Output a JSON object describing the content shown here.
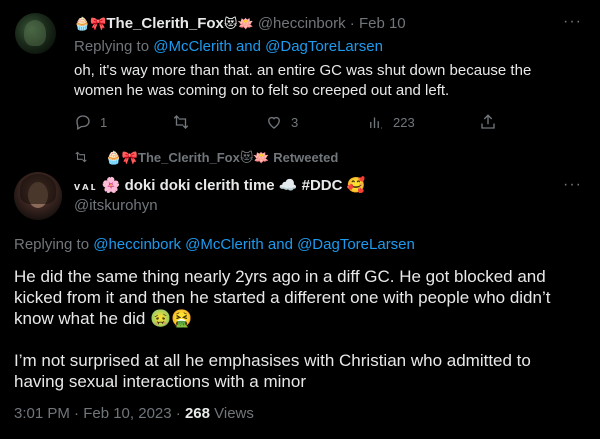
{
  "tweet1": {
    "emoji_prefix": "🧁🎀",
    "display_name": "The_Clerith_Fox",
    "emoji_suffix": "😻🪷",
    "handle": "@heccinbork",
    "date": "· Feb 10",
    "replying_prefix": "Replying to",
    "replying_to": "@McClerith and @DagToreLarsen",
    "text": "oh, it's way more than that. an entire GC was shut down because the women he was coming on to felt so creeped out and left.",
    "reply_count": "1",
    "retweet_count": "",
    "like_count": "3",
    "view_count": "223"
  },
  "retweeted_by": {
    "emoji_prefix": "🧁🎀",
    "name": "The_Clerith_Fox",
    "emoji_suffix": "😻🪷",
    "label": "Retweeted"
  },
  "tweet2": {
    "name_prefix": "ᴠᴀʟ",
    "display_name": "🌸 doki doki clerith time ☁️ #DDC 🥰",
    "handle": "@itskurohyn",
    "replying_prefix": "Replying to",
    "replying_to": "@heccinbork @McClerith and @DagToreLarsen",
    "paragraph1": "He did the same thing nearly 2yrs ago in a diff GC. He got blocked and kicked from it and then he started a different one with people who didn’t know what he did 🤢🤮",
    "paragraph2": "I’m not surprised at all he emphasises with Christian who admitted to having sexual interactions with a minor",
    "timestamp": "3:01 PM · Feb 10, 2023 ·",
    "views_count": "268",
    "views_label": "Views"
  },
  "more_icon": "···"
}
